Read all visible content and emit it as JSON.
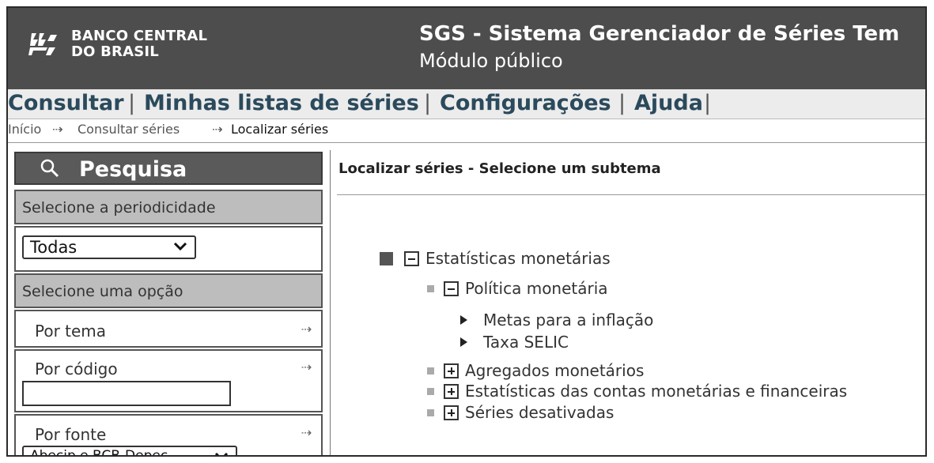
{
  "header": {
    "logo_line1": "BANCO CENTRAL",
    "logo_line2": "DO BRASIL",
    "title": "SGS - Sistema Gerenciador de Séries Tem",
    "subtitle": "Módulo público",
    "bg_color": "#4d4d4d"
  },
  "menu": {
    "items": [
      "Consultar",
      "Minhas listas de séries",
      "Configurações",
      "Ajuda"
    ],
    "separator": "|"
  },
  "breadcrumb": {
    "items": [
      "Início",
      "Consultar séries",
      "Localizar séries"
    ],
    "separator": "⇢"
  },
  "sidebar": {
    "search_title": "Pesquisa",
    "search_icon": "search-icon",
    "periodicity_label": "Selecione a periodicidade",
    "periodicity_value": "Todas",
    "option_label": "Selecione uma opção",
    "by_theme": "Por tema",
    "by_code": "Por código",
    "by_code_value": "",
    "by_source": "Por fonte",
    "by_source_value": "Abecip e BCB-Depec",
    "arrow": "⇢"
  },
  "main": {
    "title": "Localizar séries - Selecione um subtema",
    "tree": {
      "root": "Estatísticas monetárias",
      "child1": "Política monetária",
      "leaf1": "Metas para a inflação",
      "leaf2": "Taxa SELIC",
      "child2": "Agregados monetários",
      "child3": "Estatísticas das contas monetárias e financeiras",
      "child4": "Séries desativadas"
    }
  }
}
